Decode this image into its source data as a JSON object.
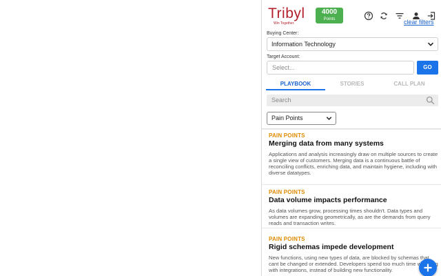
{
  "header": {
    "logo_text": "Tribyl",
    "tagline": "Win Together.",
    "points_value": "4000",
    "points_label": "Points",
    "clear_filters": "clear filters",
    "icons": [
      "help-icon",
      "refresh-icon",
      "filter-icon",
      "user-icon",
      "logout-icon"
    ]
  },
  "filters": {
    "buying_center_label": "Buying Center:",
    "buying_center_value": "Information Technology",
    "target_account_label": "Target Account:",
    "target_account_placeholder": "Select...",
    "go_label": "GO"
  },
  "tabs": [
    {
      "label": "PLAYBOOK",
      "active": true
    },
    {
      "label": "STORIES",
      "active": false
    },
    {
      "label": "CALL PLAN",
      "active": false
    }
  ],
  "search": {
    "placeholder": "Search"
  },
  "category_filter": {
    "value": "Pain Points"
  },
  "cards": [
    {
      "kind": "PAIN POINTS",
      "title": "Merging data from many systems",
      "description": "Applications and analysis increasingly draw on multiple sources to create a single view of customers. Merging data is a continuous battle of reconciling conflicts, enriching data, and maintain hygiene, including with diverse datatypes."
    },
    {
      "kind": "PAIN POINTS",
      "title": "Data volume impacts performance",
      "description": "As data volumes grow, processing times shouldn't. Data types and volumes are expanding geometrically, as are the demands from query reads and transaction writes."
    },
    {
      "kind": "PAIN POINTS",
      "title": "Rigid schemas impede development",
      "description": "New functions, using new types of data, are blocked by schemas that cant be changed or extended. Developers spend too much time wrestling with integrations, instead of building new functionality."
    }
  ],
  "colors": {
    "brand_red": "#b3202c",
    "points_green": "#4caf50",
    "accent_blue": "#1a73e8",
    "category_orange": "#e08a00"
  }
}
